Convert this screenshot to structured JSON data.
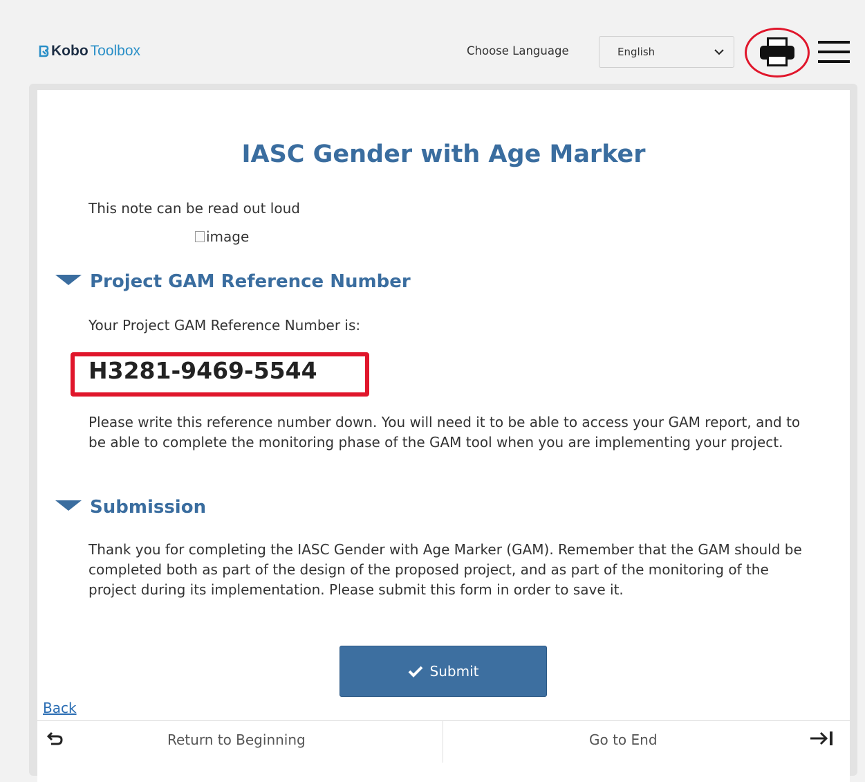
{
  "header": {
    "logo": {
      "kobo": "Kobo",
      "toolbox": "Toolbox"
    },
    "language_label": "Choose Language",
    "language_selected": "English",
    "print_icon": "printer-icon",
    "menu_icon": "hamburger-menu-icon"
  },
  "form": {
    "title": "IASC Gender with Age Marker",
    "note": "This note can be read out loud",
    "image_alt": "image",
    "groups": [
      {
        "title": "Project GAM Reference Number",
        "intro": "Your Project GAM Reference Number is:",
        "reference_number": "H3281-9469-5544",
        "instructions": "Please write this reference number down. You will need it to be able to access your GAM report, and to be able to complete the monitoring phase of the GAM tool when you are implementing your project."
      },
      {
        "title": "Submission",
        "text": "Thank you for completing the IASC Gender with Age Marker (GAM). Remember that the GAM should be completed both as part of the design of the proposed project, and as part of the monitoring of the project during its implementation. Please submit this form in order to save it."
      }
    ],
    "submit_label": "Submit"
  },
  "navigation": {
    "back_label": "Back",
    "return_label": "Return to Beginning",
    "end_label": "Go to End"
  },
  "colors": {
    "accent": "#3a6d9f",
    "highlight": "#e0162b",
    "button": "#3d6fa0"
  }
}
